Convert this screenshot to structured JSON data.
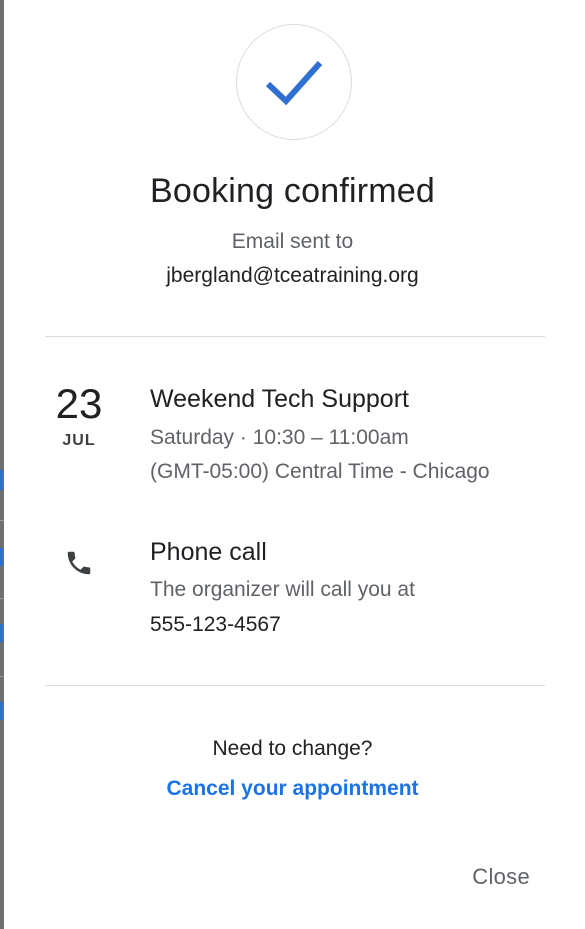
{
  "confirmation": {
    "title": "Booking confirmed",
    "email_label": "Email sent to",
    "email": "jbergland@tceatraining.org"
  },
  "event": {
    "day": "23",
    "month": "JUL",
    "title": "Weekend Tech Support",
    "time": "Saturday · 10:30 – 11:00am",
    "timezone": "(GMT-05:00) Central Time - Chicago"
  },
  "call": {
    "icon": "phone-icon",
    "title": "Phone call",
    "description": "The organizer will call you at",
    "number": "555-123-4567"
  },
  "footer": {
    "need_change": "Need to change?",
    "cancel_label": "Cancel your appointment",
    "close_label": "Close"
  },
  "colors": {
    "accent": "#1a73e8",
    "check": "#2f6fd1"
  }
}
